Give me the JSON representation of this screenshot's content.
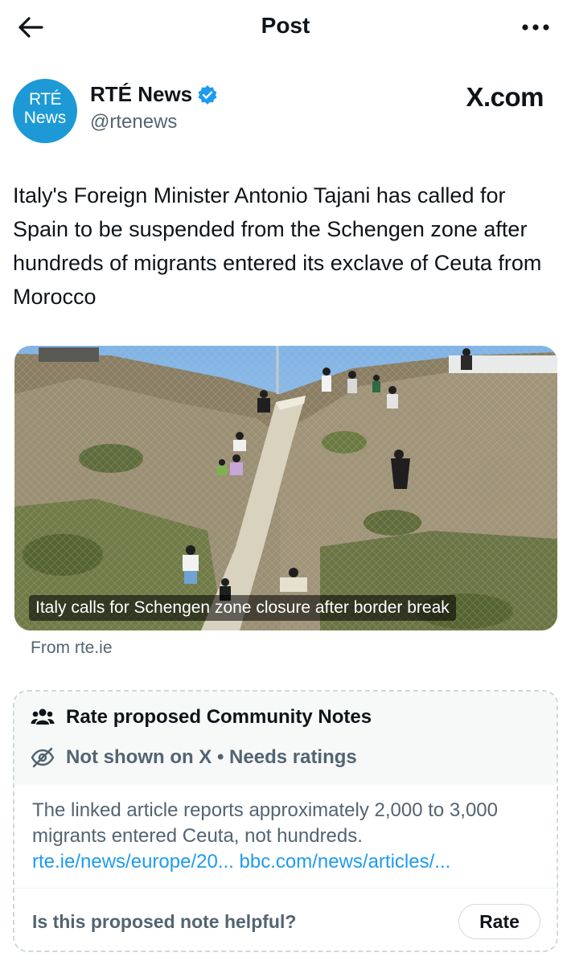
{
  "header": {
    "title": "Post",
    "back_icon": "arrow-left-icon",
    "more_icon": "more-horizontal-icon"
  },
  "author": {
    "avatar_line1": "RTÉ",
    "avatar_line2": "News",
    "avatar_color": "#1d9ad6",
    "name": "RTÉ News",
    "verified_icon": "verified-badge-icon",
    "verified_color": "#1d9bf0",
    "handle": "@rtenews",
    "source_site": "X.com"
  },
  "post": {
    "text": "Italy's Foreign Minister Antonio Tajani has called for Spain to be suspended from the Schengen zone after hundreds of migrants entered its exclave of Ceuta from Morocco"
  },
  "media": {
    "caption": "Italy calls for Schengen zone closure after border break",
    "from": "From rte.ie"
  },
  "community_notes": {
    "title": "Rate proposed Community Notes",
    "title_icon": "people-icon",
    "status": "Not shown on X • Needs ratings",
    "status_icon": "eye-off-icon",
    "body": "The linked article reports approximately 2,000 to 3,000 migrants entered Ceuta, not hundreds.",
    "link1": "rte.ie/news/europe/20...",
    "link2": "bbc.com/news/articles/...",
    "helpful_question": "Is this proposed note helpful?",
    "rate_label": "Rate"
  },
  "colors": {
    "link": "#1d9bf0",
    "secondary_text": "#536471"
  }
}
